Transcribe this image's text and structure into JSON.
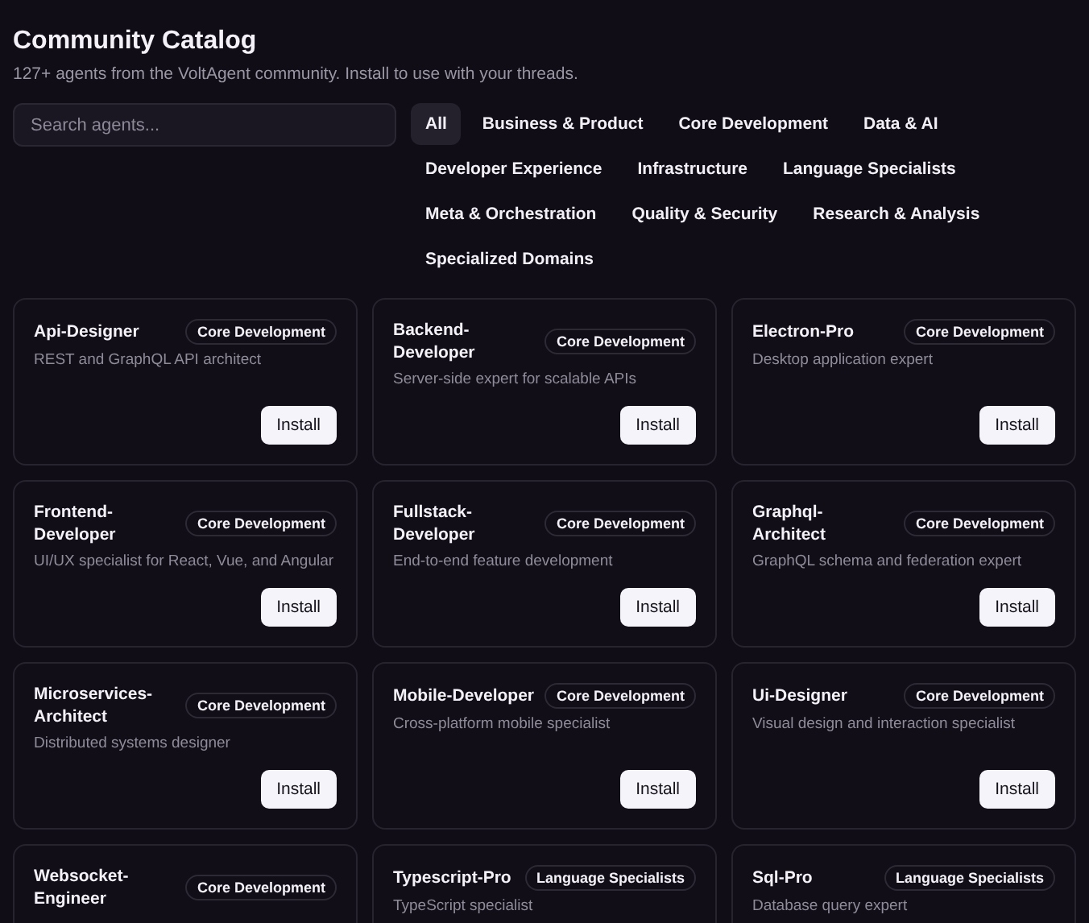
{
  "header": {
    "title": "Community Catalog",
    "subtitle": "127+ agents from the VoltAgent community. Install to use with your threads."
  },
  "search": {
    "placeholder": "Search agents..."
  },
  "filters": [
    {
      "label": "All",
      "selected": true
    },
    {
      "label": "Business & Product",
      "selected": false
    },
    {
      "label": "Core Development",
      "selected": false
    },
    {
      "label": "Data & AI",
      "selected": false
    },
    {
      "label": "Developer Experience",
      "selected": false
    },
    {
      "label": "Infrastructure",
      "selected": false
    },
    {
      "label": "Language Specialists",
      "selected": false
    },
    {
      "label": "Meta & Orchestration",
      "selected": false
    },
    {
      "label": "Quality & Security",
      "selected": false
    },
    {
      "label": "Research & Analysis",
      "selected": false
    },
    {
      "label": "Specialized Domains",
      "selected": false
    }
  ],
  "agents": [
    {
      "name": "Api-Designer",
      "category": "Core Development",
      "description": "REST and GraphQL API architect",
      "action": "Install"
    },
    {
      "name": "Backend-Developer",
      "category": "Core Development",
      "description": "Server-side expert for scalable APIs",
      "action": "Install"
    },
    {
      "name": "Electron-Pro",
      "category": "Core Development",
      "description": "Desktop application expert",
      "action": "Install"
    },
    {
      "name": "Frontend-Developer",
      "category": "Core Development",
      "description": "UI/UX specialist for React, Vue, and Angular",
      "action": "Install"
    },
    {
      "name": "Fullstack-Developer",
      "category": "Core Development",
      "description": "End-to-end feature development",
      "action": "Install"
    },
    {
      "name": "Graphql-Architect",
      "category": "Core Development",
      "description": "GraphQL schema and federation expert",
      "action": "Install"
    },
    {
      "name": "Microservices-Architect",
      "category": "Core Development",
      "description": "Distributed systems designer",
      "action": "Install"
    },
    {
      "name": "Mobile-Developer",
      "category": "Core Development",
      "description": "Cross-platform mobile specialist",
      "action": "Install"
    },
    {
      "name": "Ui-Designer",
      "category": "Core Development",
      "description": "Visual design and interaction specialist",
      "action": "Install"
    },
    {
      "name": "Websocket-Engineer",
      "category": "Core Development"
    },
    {
      "name": "Typescript-Pro",
      "category": "Language Specialists",
      "description": "TypeScript specialist"
    },
    {
      "name": "Sql-Pro",
      "category": "Language Specialists",
      "description": "Database query expert"
    }
  ]
}
